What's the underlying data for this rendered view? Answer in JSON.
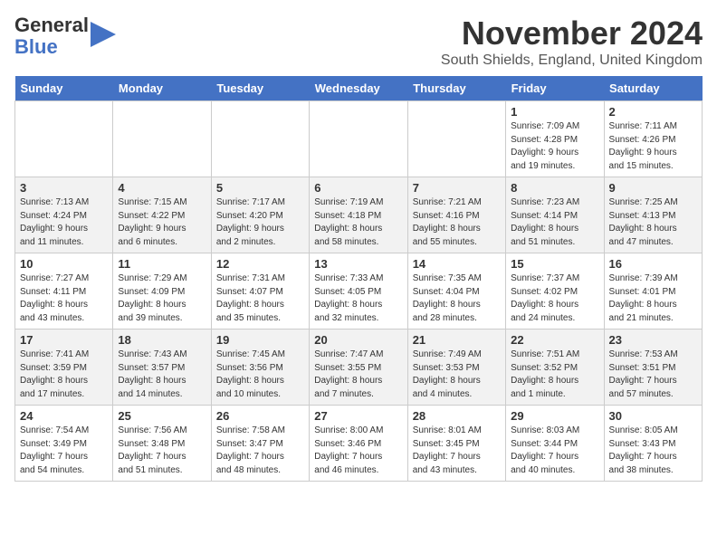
{
  "logo": {
    "line1": "General",
    "line2": "Blue"
  },
  "title": "November 2024",
  "subtitle": "South Shields, England, United Kingdom",
  "weekdays": [
    "Sunday",
    "Monday",
    "Tuesday",
    "Wednesday",
    "Thursday",
    "Friday",
    "Saturday"
  ],
  "weeks": [
    [
      {
        "day": "",
        "info": ""
      },
      {
        "day": "",
        "info": ""
      },
      {
        "day": "",
        "info": ""
      },
      {
        "day": "",
        "info": ""
      },
      {
        "day": "",
        "info": ""
      },
      {
        "day": "1",
        "info": "Sunrise: 7:09 AM\nSunset: 4:28 PM\nDaylight: 9 hours\nand 19 minutes."
      },
      {
        "day": "2",
        "info": "Sunrise: 7:11 AM\nSunset: 4:26 PM\nDaylight: 9 hours\nand 15 minutes."
      }
    ],
    [
      {
        "day": "3",
        "info": "Sunrise: 7:13 AM\nSunset: 4:24 PM\nDaylight: 9 hours\nand 11 minutes."
      },
      {
        "day": "4",
        "info": "Sunrise: 7:15 AM\nSunset: 4:22 PM\nDaylight: 9 hours\nand 6 minutes."
      },
      {
        "day": "5",
        "info": "Sunrise: 7:17 AM\nSunset: 4:20 PM\nDaylight: 9 hours\nand 2 minutes."
      },
      {
        "day": "6",
        "info": "Sunrise: 7:19 AM\nSunset: 4:18 PM\nDaylight: 8 hours\nand 58 minutes."
      },
      {
        "day": "7",
        "info": "Sunrise: 7:21 AM\nSunset: 4:16 PM\nDaylight: 8 hours\nand 55 minutes."
      },
      {
        "day": "8",
        "info": "Sunrise: 7:23 AM\nSunset: 4:14 PM\nDaylight: 8 hours\nand 51 minutes."
      },
      {
        "day": "9",
        "info": "Sunrise: 7:25 AM\nSunset: 4:13 PM\nDaylight: 8 hours\nand 47 minutes."
      }
    ],
    [
      {
        "day": "10",
        "info": "Sunrise: 7:27 AM\nSunset: 4:11 PM\nDaylight: 8 hours\nand 43 minutes."
      },
      {
        "day": "11",
        "info": "Sunrise: 7:29 AM\nSunset: 4:09 PM\nDaylight: 8 hours\nand 39 minutes."
      },
      {
        "day": "12",
        "info": "Sunrise: 7:31 AM\nSunset: 4:07 PM\nDaylight: 8 hours\nand 35 minutes."
      },
      {
        "day": "13",
        "info": "Sunrise: 7:33 AM\nSunset: 4:05 PM\nDaylight: 8 hours\nand 32 minutes."
      },
      {
        "day": "14",
        "info": "Sunrise: 7:35 AM\nSunset: 4:04 PM\nDaylight: 8 hours\nand 28 minutes."
      },
      {
        "day": "15",
        "info": "Sunrise: 7:37 AM\nSunset: 4:02 PM\nDaylight: 8 hours\nand 24 minutes."
      },
      {
        "day": "16",
        "info": "Sunrise: 7:39 AM\nSunset: 4:01 PM\nDaylight: 8 hours\nand 21 minutes."
      }
    ],
    [
      {
        "day": "17",
        "info": "Sunrise: 7:41 AM\nSunset: 3:59 PM\nDaylight: 8 hours\nand 17 minutes."
      },
      {
        "day": "18",
        "info": "Sunrise: 7:43 AM\nSunset: 3:57 PM\nDaylight: 8 hours\nand 14 minutes."
      },
      {
        "day": "19",
        "info": "Sunrise: 7:45 AM\nSunset: 3:56 PM\nDaylight: 8 hours\nand 10 minutes."
      },
      {
        "day": "20",
        "info": "Sunrise: 7:47 AM\nSunset: 3:55 PM\nDaylight: 8 hours\nand 7 minutes."
      },
      {
        "day": "21",
        "info": "Sunrise: 7:49 AM\nSunset: 3:53 PM\nDaylight: 8 hours\nand 4 minutes."
      },
      {
        "day": "22",
        "info": "Sunrise: 7:51 AM\nSunset: 3:52 PM\nDaylight: 8 hours\nand 1 minute."
      },
      {
        "day": "23",
        "info": "Sunrise: 7:53 AM\nSunset: 3:51 PM\nDaylight: 7 hours\nand 57 minutes."
      }
    ],
    [
      {
        "day": "24",
        "info": "Sunrise: 7:54 AM\nSunset: 3:49 PM\nDaylight: 7 hours\nand 54 minutes."
      },
      {
        "day": "25",
        "info": "Sunrise: 7:56 AM\nSunset: 3:48 PM\nDaylight: 7 hours\nand 51 minutes."
      },
      {
        "day": "26",
        "info": "Sunrise: 7:58 AM\nSunset: 3:47 PM\nDaylight: 7 hours\nand 48 minutes."
      },
      {
        "day": "27",
        "info": "Sunrise: 8:00 AM\nSunset: 3:46 PM\nDaylight: 7 hours\nand 46 minutes."
      },
      {
        "day": "28",
        "info": "Sunrise: 8:01 AM\nSunset: 3:45 PM\nDaylight: 7 hours\nand 43 minutes."
      },
      {
        "day": "29",
        "info": "Sunrise: 8:03 AM\nSunset: 3:44 PM\nDaylight: 7 hours\nand 40 minutes."
      },
      {
        "day": "30",
        "info": "Sunrise: 8:05 AM\nSunset: 3:43 PM\nDaylight: 7 hours\nand 38 minutes."
      }
    ]
  ]
}
